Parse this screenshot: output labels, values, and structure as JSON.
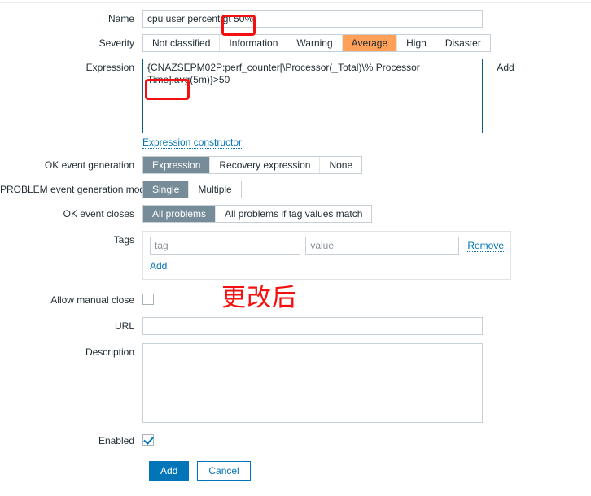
{
  "form": {
    "name": {
      "label": "Name",
      "value": "cpu user percent gt 50%",
      "placeholder": ""
    },
    "severity": {
      "label": "Severity",
      "options": [
        "Not classified",
        "Information",
        "Warning",
        "Average",
        "High",
        "Disaster"
      ],
      "selected": "Average",
      "selected_color": "#ffa059"
    },
    "expression": {
      "label": "Expression",
      "value": "{CNAZSEPM02P:perf_counter[\\Processor(_Total)\\% Processor Time].avg(5m)}>50",
      "add_button": "Add",
      "constructor_link": "Expression constructor",
      "focus_border_color": "#0a5a8c"
    },
    "ok_event_generation": {
      "label": "OK event generation",
      "options": [
        "Expression",
        "Recovery expression",
        "None"
      ],
      "selected": "Expression"
    },
    "problem_event_generation_mode": {
      "label": "PROBLEM event generation mode",
      "options": [
        "Single",
        "Multiple"
      ],
      "selected": "Single"
    },
    "ok_event_closes": {
      "label": "OK event closes",
      "options": [
        "All problems",
        "All problems if tag values match"
      ],
      "selected": "All problems"
    },
    "tags": {
      "label": "Tags",
      "rows": [
        {
          "tag_placeholder": "tag",
          "tag_value": "",
          "value_placeholder": "value",
          "value_value": "",
          "remove_label": "Remove"
        }
      ],
      "add_label": "Add"
    },
    "allow_manual_close": {
      "label": "Allow manual close",
      "checked": false
    },
    "url": {
      "label": "URL",
      "value": "",
      "placeholder": ""
    },
    "description": {
      "label": "Description",
      "value": "",
      "placeholder": ""
    },
    "enabled": {
      "label": "Enabled",
      "checked": true
    },
    "footer": {
      "submit_label": "Add",
      "cancel_label": "Cancel"
    }
  },
  "annotations": {
    "name_highlight": "50%",
    "expression_highlight": ">50",
    "chinese_note": "更改后",
    "color": "#f41010"
  },
  "theme": {
    "selected_radio_bg": "#768d99",
    "link_color": "#0275b8",
    "primary_button_bg": "#0275b8",
    "input_border": "#c7d0d6"
  }
}
